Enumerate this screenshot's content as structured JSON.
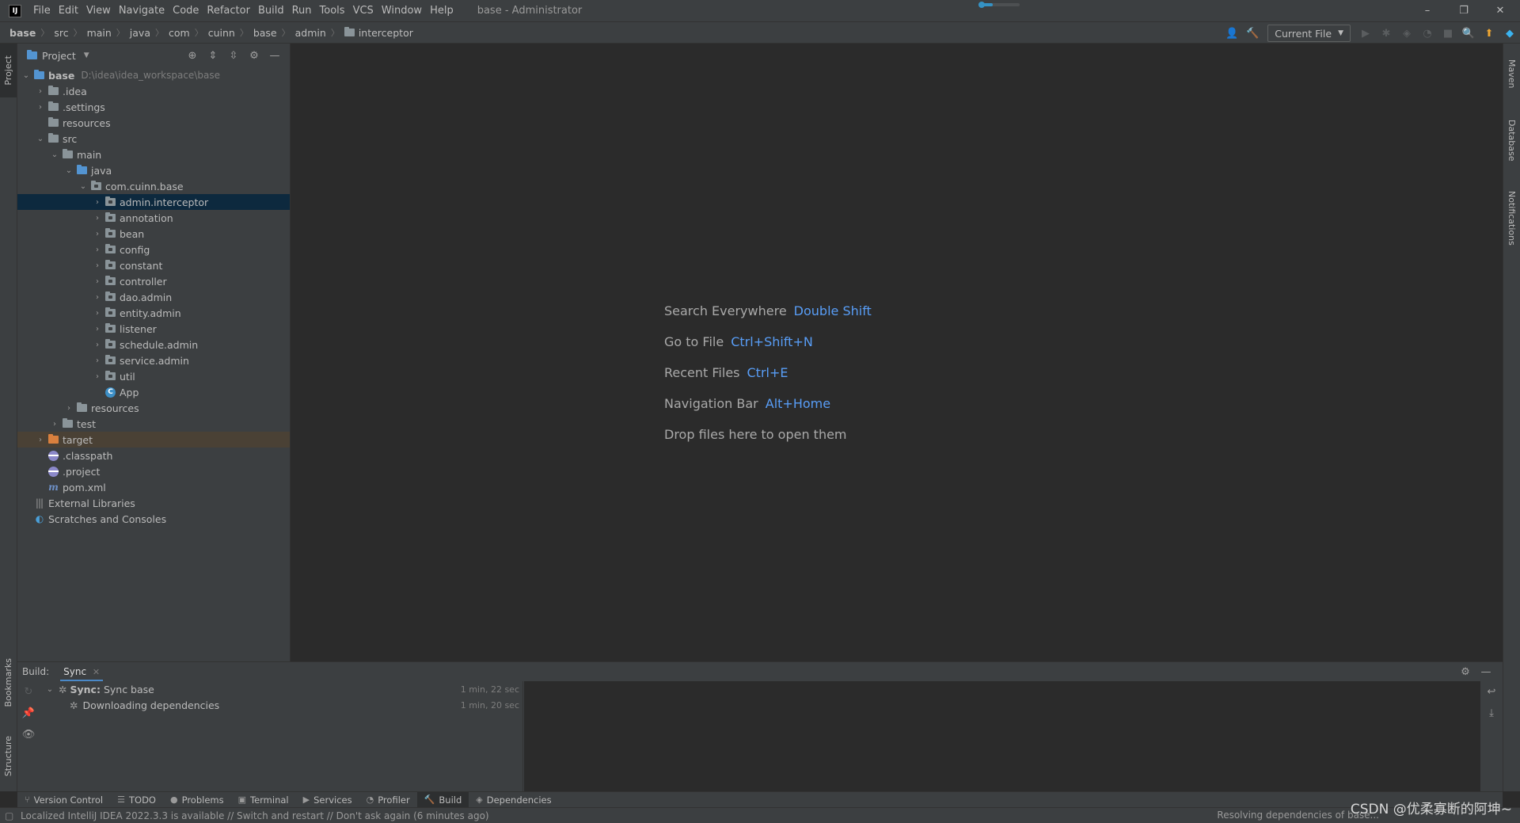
{
  "menu": {
    "logo": "IJ",
    "items": [
      "File",
      "Edit",
      "View",
      "Navigate",
      "Code",
      "Refactor",
      "Build",
      "Run",
      "Tools",
      "VCS",
      "Window",
      "Help"
    ],
    "window_title": "base - Administrator",
    "window_controls": [
      "–",
      "❐",
      "✕"
    ],
    "sync_progress": 0.35
  },
  "breadcrumb": [
    "base",
    "src",
    "main",
    "java",
    "com",
    "cuinn",
    "base",
    "admin",
    "interceptor"
  ],
  "toolbar": {
    "run_config": "Current File"
  },
  "left_stripe": {
    "project": "Project",
    "bookmarks": "Bookmarks",
    "structure": "Structure"
  },
  "right_stripe": {
    "maven": "Maven",
    "database": "Database",
    "notifications": "Notifications"
  },
  "project_panel": {
    "title": "Project",
    "root_name": "base",
    "root_path": "D:\\idea\\idea_workspace\\base",
    "rows": [
      {
        "label": ".idea"
      },
      {
        "label": ".settings"
      },
      {
        "label": "resources"
      },
      {
        "label": "src"
      },
      {
        "label": "main"
      },
      {
        "label": "java"
      },
      {
        "label": "com.cuinn.base"
      },
      {
        "label": "admin.interceptor"
      },
      {
        "label": "annotation"
      },
      {
        "label": "bean"
      },
      {
        "label": "config"
      },
      {
        "label": "constant"
      },
      {
        "label": "controller"
      },
      {
        "label": "dao.admin"
      },
      {
        "label": "entity.admin"
      },
      {
        "label": "listener"
      },
      {
        "label": "schedule.admin"
      },
      {
        "label": "service.admin"
      },
      {
        "label": "util"
      },
      {
        "label": "App"
      },
      {
        "label": "resources"
      },
      {
        "label": "test"
      },
      {
        "label": "target"
      },
      {
        "label": ".classpath"
      },
      {
        "label": ".project"
      },
      {
        "label": "pom.xml"
      },
      {
        "label": "External Libraries"
      },
      {
        "label": "Scratches and Consoles"
      }
    ]
  },
  "editor_hints": [
    {
      "label": "Search Everywhere",
      "key": "Double Shift"
    },
    {
      "label": "Go to File",
      "key": "Ctrl+Shift+N"
    },
    {
      "label": "Recent Files",
      "key": "Ctrl+E"
    },
    {
      "label": "Navigation Bar",
      "key": "Alt+Home"
    },
    {
      "label": "Drop files here to open them",
      "key": ""
    }
  ],
  "build": {
    "label": "Build:",
    "tab": "Sync",
    "rows": [
      {
        "bold": "Sync:",
        "text": "Sync base",
        "time": "1 min, 22 sec"
      },
      {
        "bold": "",
        "text": "Downloading dependencies",
        "time": "1 min, 20 sec"
      }
    ]
  },
  "bottom_tabs": [
    "Version Control",
    "TODO",
    "Problems",
    "Terminal",
    "Services",
    "Profiler",
    "Build",
    "Dependencies"
  ],
  "status": {
    "message": "Localized IntelliJ IDEA 2022.3.3 is available // Switch and restart // Don't ask again (6 minutes ago)",
    "right": "Resolving dependencies of base..."
  },
  "watermark": "CSDN @优柔寡断的阿坤~"
}
